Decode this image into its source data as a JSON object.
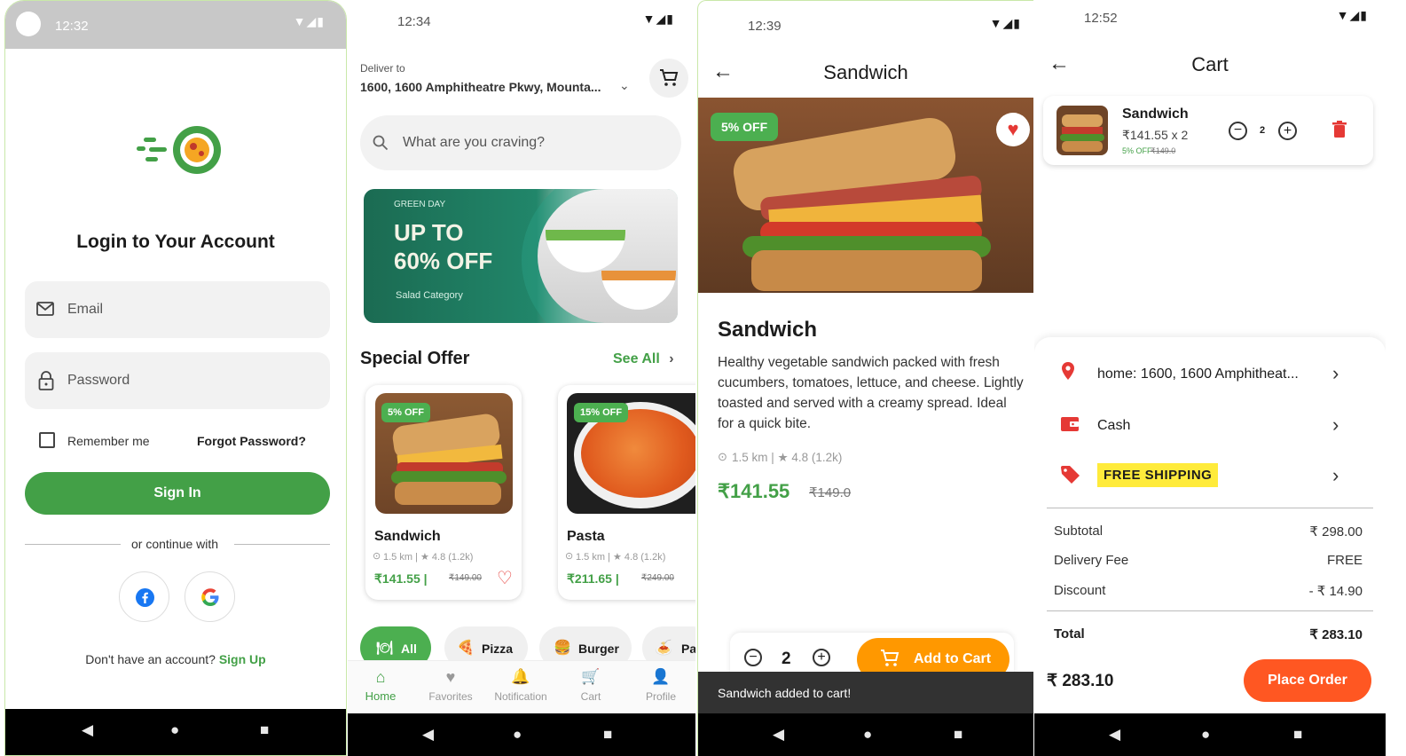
{
  "colors": {
    "primary_green": "#4caf50",
    "orange": "#ff9800",
    "place_order_red": "#ff5722",
    "yellow_badge": "#ffeb3b"
  },
  "login": {
    "time": "12:32",
    "title": "Login to Your Account",
    "email_placeholder": "Email",
    "password_placeholder": "Password",
    "remember_me": "Remember me",
    "forgot_password": "Forgot Password?",
    "sign_in": "Sign In",
    "continue_with": "or continue with",
    "no_account": "Don't have an account?",
    "sign_up": "Sign Up",
    "social": [
      "facebook-icon",
      "google-icon"
    ]
  },
  "home": {
    "time": "12:34",
    "deliver_to_label": "Deliver to",
    "address": "1600, 1600 Amphitheatre Pkwy, Mounta...",
    "search_placeholder": "What are you craving?",
    "banner": {
      "tag": "GREEN DAY",
      "line1": "UP TO",
      "line2": "60% OFF",
      "category": "Salad Category"
    },
    "special_offer_title": "Special Offer",
    "see_all": "See All",
    "offers": [
      {
        "badge": "5% OFF",
        "name": "Sandwich",
        "meta": "1.5 km | ★ 4.8 (1.2k)",
        "price": "₹141.55 |",
        "old_price": "₹149.00"
      },
      {
        "badge": "15% OFF",
        "name": "Pasta",
        "meta": "1.5 km | ★ 4.8 (1.2k)",
        "price": "₹211.65 |",
        "old_price": "₹249.00"
      }
    ],
    "categories": [
      "All",
      "Pizza",
      "Burger",
      "Pa"
    ],
    "nav": [
      "Home",
      "Favorites",
      "Notification",
      "Cart",
      "Profile"
    ]
  },
  "detail": {
    "time": "12:39",
    "header_title": "Sandwich",
    "badge": "5% OFF",
    "name": "Sandwich",
    "description": "Healthy vegetable sandwich packed with fresh cucumbers, tomatoes, lettuce, and cheese. Lightly toasted and served with a creamy spread. Ideal for a quick bite.",
    "meta": "1.5 km | ★ 4.8 (1.2k)",
    "price": "₹141.55",
    "old_price": "₹149.0",
    "quantity": "2",
    "add_to_cart": "Add to Cart",
    "snackbar": "Sandwich added to cart!"
  },
  "cart": {
    "time": "12:52",
    "header_title": "Cart",
    "item": {
      "name": "Sandwich",
      "price_line": "₹141.55 x 2",
      "discount": "5% OFF",
      "old_price": "₹149.0",
      "qty": "2"
    },
    "address": "home: 1600, 1600 Amphitheat...",
    "payment": "Cash",
    "coupon": "FREE SHIPPING",
    "subtotal_label": "Subtotal",
    "subtotal": "₹ 298.00",
    "delivery_label": "Delivery Fee",
    "delivery": "FREE",
    "discount_label": "Discount",
    "discount": "- ₹ 14.90",
    "total_label": "Total",
    "total": "₹ 283.10",
    "grand_total": "₹ 283.10",
    "place_order": "Place Order"
  }
}
